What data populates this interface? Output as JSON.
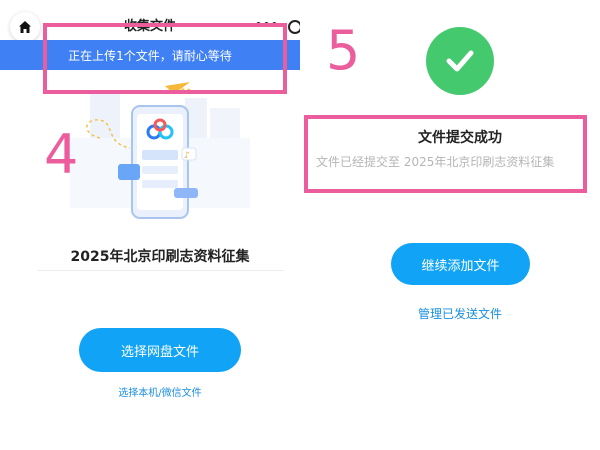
{
  "left": {
    "header": {
      "title": "收集文件",
      "more_label": "•••"
    },
    "upload_banner": "正在上传1个文件，请耐心等待",
    "collection_title": "2025年北京印刷志资料征集",
    "select_cloud_button": "选择网盘文件",
    "select_local_link": "选择本机/微信文件"
  },
  "right": {
    "success_title": "文件提交成功",
    "success_desc": "文件已经提交至  2025年北京印刷志资料征集",
    "continue_button": "继续添加文件",
    "manage_link": "管理已发送文件"
  },
  "annotations": {
    "step_a": "4",
    "step_b": "5"
  },
  "colors": {
    "primary_blue": "#11a3f5",
    "banner_blue": "#3f80f5",
    "success_green": "#45c96f",
    "annotation_pink": "#ec5d9e",
    "link_blue": "#1a8fe0"
  },
  "icons": {
    "home": "home-icon",
    "success": "check-icon",
    "cloud": "baidu-netdisk-logo-icon"
  }
}
